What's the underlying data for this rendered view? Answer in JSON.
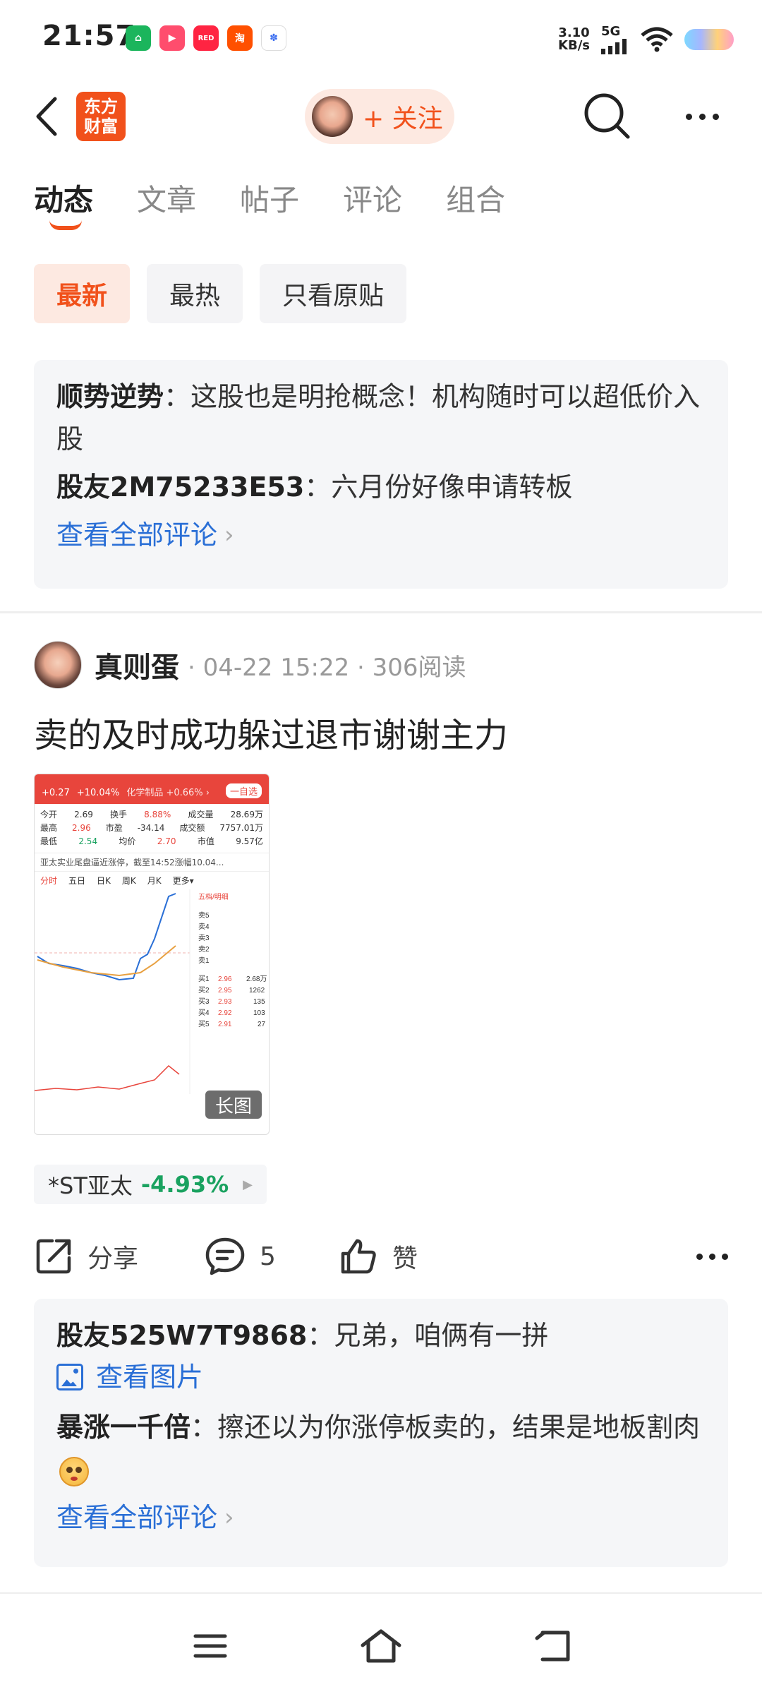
{
  "status_bar": {
    "time": "21:57",
    "net_speed_value": "3.10",
    "net_speed_unit": "KB/s",
    "network": "5G",
    "app_icons": [
      {
        "name": "home-app-icon",
        "color": "#1bb55c"
      },
      {
        "name": "video-app-icon",
        "color": "#ff4d6d"
      },
      {
        "name": "xiaohongshu-app-icon",
        "color": "#ff2442"
      },
      {
        "name": "taobao-app-icon",
        "color": "#ff5000"
      },
      {
        "name": "baidu-app-icon",
        "color": "#3a6df0"
      }
    ]
  },
  "header": {
    "logo_text_line1": "东方",
    "logo_text_line2": "财富",
    "follow_label": "+ 关注",
    "brand_color": "#f1511b"
  },
  "tabs": [
    {
      "label": "动态",
      "active": true
    },
    {
      "label": "文章",
      "active": false
    },
    {
      "label": "帖子",
      "active": false
    },
    {
      "label": "评论",
      "active": false
    },
    {
      "label": "组合",
      "active": false
    }
  ],
  "filters": [
    {
      "label": "最新",
      "active": true
    },
    {
      "label": "最热",
      "active": false
    },
    {
      "label": "只看原贴",
      "active": false
    }
  ],
  "comment_block_1": {
    "comments": [
      {
        "user": "顺势逆势",
        "text": "这股也是明抢概念！机构随时可以超低价入股"
      },
      {
        "user": "股友2M75233E53",
        "text": "六月份好像申请转板"
      }
    ],
    "view_all": "查看全部评论"
  },
  "post": {
    "author": "真则蛋",
    "date": "04-22 15:22",
    "reads": "306阅读",
    "title": "卖的及时成功躲过退市谢谢主力",
    "image": {
      "change": "+0.27",
      "change_pct": "+10.04%",
      "sector": "化学制品 +0.66% ›",
      "add_btn": "一自选",
      "rows": [
        [
          "今开",
          "2.69",
          "换手",
          "8.88%",
          "成交量",
          "28.69万"
        ],
        [
          "最高",
          "2.96",
          "市盈",
          "-34.14",
          "成交额",
          "7757.01万"
        ],
        [
          "最低",
          "2.54",
          "均价",
          "2.70",
          "市值",
          "9.57亿"
        ]
      ],
      "news": "亚太实业尾盘逼近涨停，截至14:52涨幅10.04...",
      "chart_tabs": [
        "分时",
        "五日",
        "日K",
        "周K",
        "月K",
        "更多▾"
      ],
      "long_image_badge": "长图"
    },
    "stock": {
      "name": "*ST亚太",
      "change": "-4.93%"
    },
    "share_label": "分享",
    "comment_count": "5",
    "like_label": "赞"
  },
  "comment_block_2": {
    "comments": [
      {
        "user": "股友525W7T9868",
        "text": "兄弟，咱俩有一拼"
      },
      {
        "user": "暴涨一千倍",
        "text": "擦还以为你涨停板卖的，结果是地板割肉"
      }
    ],
    "view_image": "查看图片",
    "view_all": "查看全部评论"
  }
}
